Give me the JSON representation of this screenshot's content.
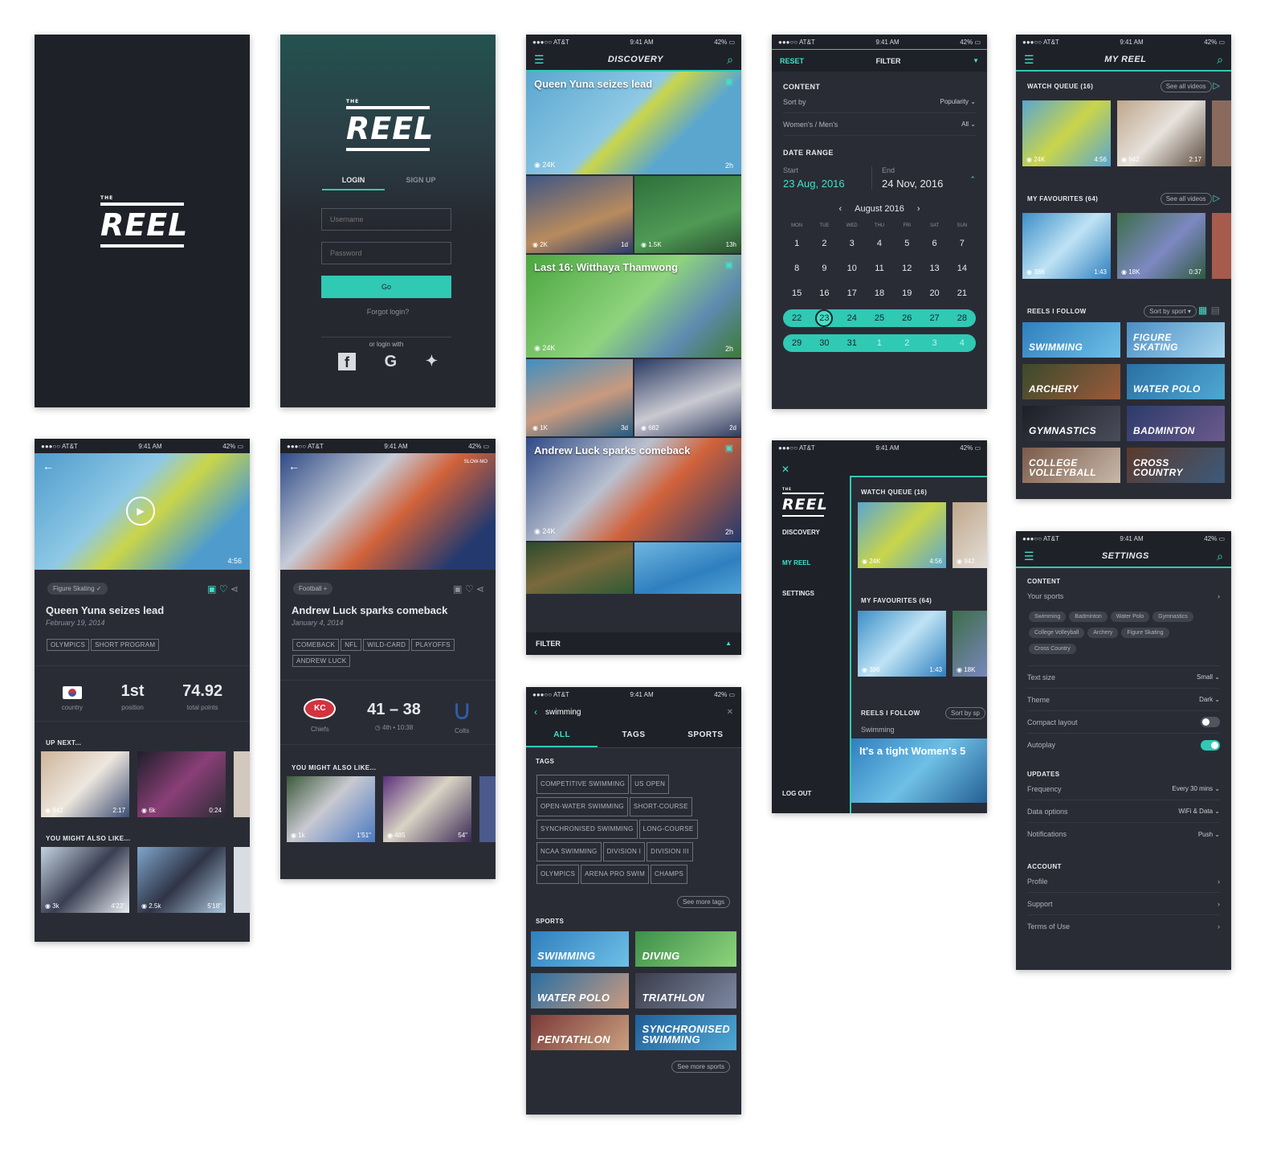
{
  "brand": {
    "the": "THE",
    "name": "REEL"
  },
  "status": {
    "carrier": "●●●○○ AT&T ",
    "time": "9:41 AM",
    "battery": "42% ▭"
  },
  "login": {
    "tab_login": "LOGIN",
    "tab_signup": "SIGN UP",
    "username_placeholder": "Username",
    "password_placeholder": "Password",
    "go": "Go",
    "forgot": "Forgot login?",
    "or_login_with": "or login with"
  },
  "discovery": {
    "title": "DISCOVERY",
    "filter": "FILTER",
    "hero1": {
      "title": "Queen Yuna seizes lead",
      "views": "◉ 24K",
      "age": "2h"
    },
    "grid1": [
      {
        "views": "◉ 2K",
        "age": "1d"
      },
      {
        "views": "◉ 1.5K",
        "age": "13h"
      }
    ],
    "hero2": {
      "title": "Last 16: Witthaya Thamwong",
      "views": "◉ 24K",
      "age": "2h"
    },
    "grid2": [
      {
        "views": "◉ 1K",
        "age": "3d"
      },
      {
        "views": "◉ 682",
        "age": "2d"
      }
    ],
    "hero3": {
      "title": "Andrew Luck sparks comeback",
      "views": "◉ 24K",
      "age": "2h"
    }
  },
  "filter": {
    "reset": "RESET",
    "title": "FILTER",
    "content": "CONTENT",
    "sort_by": "Sort by",
    "sort_val": "Popularity",
    "gender": "Women's / Men's",
    "gender_val": "All",
    "date_range": "DATE RANGE",
    "start": "Start",
    "start_val": "23 Aug, 2016",
    "end": "End",
    "end_val": "24 Nov, 2016",
    "month": "August 2016",
    "weekdays": [
      "MON",
      "TUE",
      "WED",
      "THU",
      "FRI",
      "SAT",
      "SUN"
    ],
    "days": [
      "1",
      "2",
      "3",
      "4",
      "5",
      "6",
      "7",
      "8",
      "9",
      "10",
      "11",
      "12",
      "13",
      "14",
      "15",
      "16",
      "17",
      "18",
      "19",
      "20",
      "21"
    ],
    "range1": [
      "22",
      "23",
      "24",
      "25",
      "26",
      "27",
      "28"
    ],
    "range2": [
      "29",
      "30",
      "31",
      "1",
      "2",
      "3",
      "4"
    ]
  },
  "myreel": {
    "title": "MY REEL",
    "watch_queue": "WATCH QUEUE (16)",
    "see_all": "See all videos",
    "favourites": "MY FAVOURITES (64)",
    "reels_follow": "REELS I FOLLOW",
    "sort_sport": "Sort by sport ▾",
    "wq": [
      {
        "views": "◉ 24K",
        "dur": "4:56"
      },
      {
        "views": "◉ 942",
        "dur": "2:17"
      }
    ],
    "fav": [
      {
        "views": "◉ 386",
        "dur": "1:43"
      },
      {
        "views": "◉ 18K",
        "dur": "0:37"
      }
    ],
    "sports": [
      "SWIMMING",
      "FIGURE SKATING",
      "ARCHERY",
      "WATER POLO",
      "GYMNASTICS",
      "BADMINTON",
      "COLLEGE VOLLEYBALL",
      "CROSS COUNTRY"
    ]
  },
  "menu": {
    "discovery": "DISCOVERY",
    "myreel": "MY REEL",
    "settings": "SETTINGS",
    "logout": "LOG OUT",
    "watch_queue": "WATCH QUEUE (16)",
    "favourites": "MY FAVOURITES (64)",
    "reels_follow": "REELS I FOLLOW",
    "sort_sp": "Sort by sp",
    "swimming": "Swimming",
    "headline": "It's a tight Women's 5",
    "wq_views": "◉ 24K",
    "wq_dur": "4:56",
    "wq2": "◉ 942",
    "fav_views": "◉ 386",
    "fav_dur": "1:43",
    "fav2": "◉ 18K"
  },
  "settings": {
    "title": "SETTINGS",
    "content": "CONTENT",
    "your_sports": "Your sports",
    "sports": [
      "Swimming",
      "Badminton",
      "Water Polo",
      "Gymnastics",
      "College Volleyball",
      "Archery",
      "Figure Skating",
      "Cross Country"
    ],
    "text_size": "Text size",
    "text_size_val": "Small",
    "theme": "Theme",
    "theme_val": "Dark",
    "compact": "Compact layout",
    "autoplay": "Autoplay",
    "compact_on": false,
    "autoplay_on": true,
    "updates": "UPDATES",
    "frequency": "Frequency",
    "frequency_val": "Every 30 mins",
    "data_options": "Data options",
    "data_val": "WiFi & Data",
    "notifications": "Notifications",
    "notif_val": "Push",
    "account": "ACCOUNT",
    "profile": "Profile",
    "support": "Support",
    "terms": "Terms of Use"
  },
  "detail1": {
    "sport": "Figure Skating ✓",
    "title": "Queen Yuna seizes lead",
    "date": "February 19, 2014",
    "tags": [
      "OLYMPICS",
      "SHORT PROGRAM"
    ],
    "duration": "4:56",
    "stat2": "1st",
    "stat2_lbl": "position",
    "stat3": "74.92",
    "stat3_lbl": "total points",
    "stat1_lbl": "country",
    "up_next": "UP NEXT...",
    "might_like": "YOU MIGHT ALSO LIKE...",
    "next": [
      {
        "views": "◉ 942",
        "dur": "2:17"
      },
      {
        "views": "◉ 6k",
        "dur": "0:24"
      }
    ],
    "like": [
      {
        "views": "◉ 3k",
        "dur": "4'23\""
      },
      {
        "views": "◉ 2.5k",
        "dur": "5'18\""
      }
    ]
  },
  "detail2": {
    "sport": "Football +",
    "title": "Andrew Luck sparks comeback",
    "date": "January 4, 2014",
    "tags": [
      "COMEBACK",
      "NFL",
      "WILD-CARD",
      "PLAYOFFS",
      "ANDREW LUCK"
    ],
    "score": "41 – 38",
    "time": "◷ 4th • 10:38",
    "team1": "Chiefs",
    "team2": "Colts",
    "might_like": "YOU MIGHT ALSO LIKE...",
    "slow": "SLOW-MO",
    "like": [
      {
        "views": "◉ 1k",
        "dur": "1'51\""
      },
      {
        "views": "◉ 485",
        "dur": "54\""
      }
    ]
  },
  "search": {
    "query": "swimming",
    "tab_all": "ALL",
    "tab_tags": "TAGS",
    "tab_sports": "SPORTS",
    "tags_title": "TAGS",
    "tags": [
      "COMPETITIVE SWIMMING",
      "US OPEN",
      "OPEN-WATER SWIMMING",
      "SHORT-COURSE",
      "SYNCHRONISED SWIMMING",
      "LONG-COURSE",
      "NCAA SWIMMING",
      "DIVISION I",
      "DIVISION III",
      "OLYMPICS",
      "ARENA PRO SWIM",
      "CHAMPS"
    ],
    "see_more_tags": "See more tags",
    "sports_title": "SPORTS",
    "sports": [
      "SWIMMING",
      "DIVING",
      "WATER POLO",
      "TRIATHLON",
      "PENTATHLON",
      "SYNCHRONISED SWIMMING"
    ],
    "see_more_sports": "See more sports"
  }
}
